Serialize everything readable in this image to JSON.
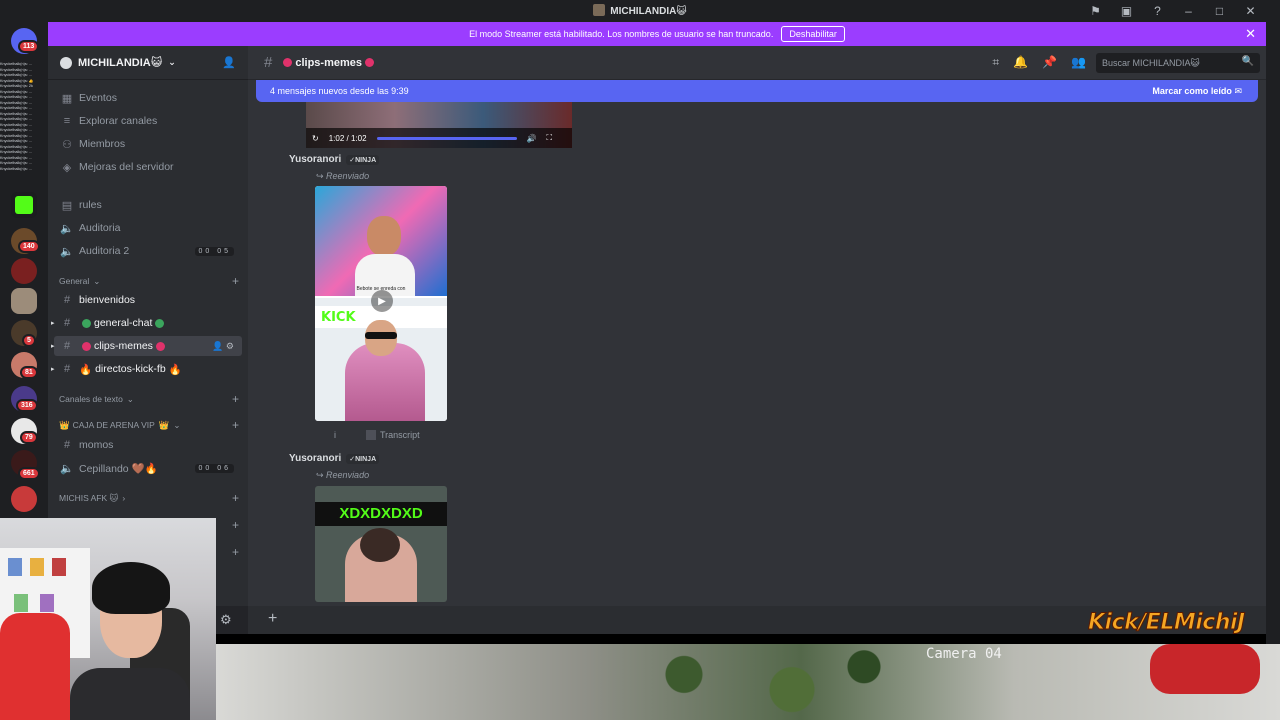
{
  "window": {
    "title": "MICHILANDIA😺"
  },
  "banner": {
    "text": "El modo Streamer está habilitado. Los nombres de usuario se han truncado.",
    "button": "Deshabilitar"
  },
  "rail": {
    "badges": [
      "113",
      "140",
      "5",
      "81",
      "316",
      "79",
      "661"
    ]
  },
  "overlay_chat": [
    "Knyckelhalk(n)s: ...",
    "Knyckelhalk(n)s: ...",
    "Knyckelhalk(n)s: ...",
    "Knyckelhalk(n)s: 👍",
    "Knyckelhalk(n)s: 2k",
    "Knyckelhalk(n)s: ...",
    "Knyckelhalk(n)s: ...",
    "Knyckelhalk(n)s: ...",
    "Knyckelhalk(n)s: ...",
    "Knyckelhalk(n)s: ...",
    "Knyckelhalk(n)s: ...",
    "Knyckelhalk(n)s: ...",
    "Knyckelhalk(n)s: ...",
    "Knyckelhalk(n)s: ...",
    "Knyckelhalk(n)s: ...",
    "Knyckelhalk(n)s: ...",
    "Knyckelhalk(n)s: ...",
    "Knyckelhalk(n)s: ...",
    "Knyckelhalk(n)s: ...",
    "Knyckelhalk(n)s: ..."
  ],
  "sidebar": {
    "server_name": "MICHILANDIA😺",
    "events": "Eventos",
    "browse": "Explorar canales",
    "members": "Miembros",
    "boosts": "Mejoras del servidor",
    "rules": "rules",
    "auditoria": "Auditoria",
    "auditoria2": "Auditoria 2",
    "auditoria2_count": "00 05",
    "cat_general": "General",
    "bienvenidos": "bienvenidos",
    "general_chat": "general-chat",
    "clips_memes": "clips-memes",
    "directos": "directos-kick-fb",
    "cat_texto": "Canales de texto",
    "cat_caja": "CAJA DE ARENA VIP",
    "momos": "momos",
    "cepillando": "Cepillando 🤎🔥",
    "cepillando_count": "00 06",
    "cat_michis": "MICHIS AFK 🐱"
  },
  "main": {
    "channel": "clips-memes",
    "search_placeholder": "Buscar MICHILANDIA😺",
    "new_messages": "4 mensajes nuevos desde las 9:39",
    "mark_read": "Marcar como leído",
    "video_time": "1:02 / 1:02",
    "author": "Yusoranori",
    "author_tag": "✓NINJA",
    "forwarded": "Reenviado",
    "thumb1_caption": "Bebote se enreda con",
    "kick_text": "KICK",
    "info_char": "i",
    "transcript": "Transcript",
    "thumb2_text": "XDXDXDXD"
  },
  "stream": {
    "camera_label": "Camera 04",
    "kick_logo": "Kick/ELMichiJ"
  }
}
